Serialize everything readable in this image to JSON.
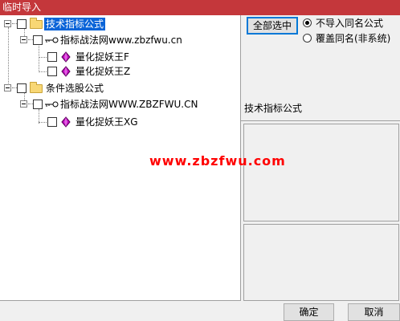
{
  "window": {
    "title": "临时导入"
  },
  "tree": {
    "nodes": [
      {
        "label": "技术指标公式",
        "selected": true
      },
      {
        "label": "指标战法网www.zbzfwu.cn"
      },
      {
        "label": "量化捉妖王F"
      },
      {
        "label": "量化捉妖王Z"
      },
      {
        "label": "条件选股公式"
      },
      {
        "label": "指标战法网WWW.ZBZFWU.CN"
      },
      {
        "label": "量化捉妖王XG"
      }
    ]
  },
  "options": {
    "select_all_label": "全部选中",
    "radio_no_import": "不导入同名公式",
    "radio_overwrite": "覆盖同名(非系统)",
    "selected_radio": "no_import"
  },
  "detail": {
    "title": "技术指标公式"
  },
  "watermark": "www.zbzfwu.com",
  "footer": {
    "ok_label": "确定",
    "cancel_label": "取消"
  },
  "colors": {
    "titlebar": "#c4373b",
    "selection": "#0a64d8",
    "watermark": "#ff0000",
    "gem": "#c000c0"
  },
  "icons": [
    "folder-icon",
    "key-icon",
    "gem-icon",
    "checkbox-icon",
    "expander-icon"
  ]
}
